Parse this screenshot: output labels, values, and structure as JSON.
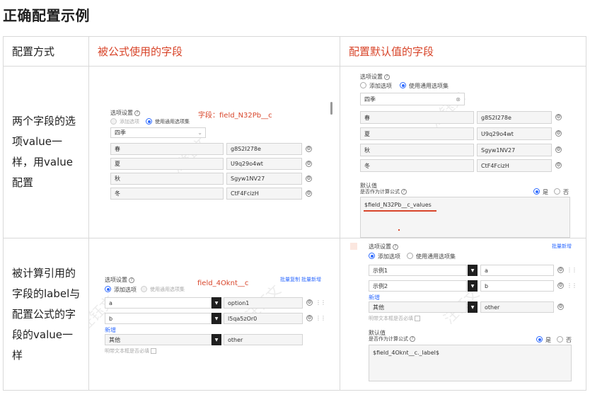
{
  "title": "正确配置示例",
  "table": {
    "headers": [
      "配置方式",
      "被公式使用的字段",
      "配置默认值的字段"
    ],
    "rows": [
      {
        "desc": "两个字段的选项value一样，用value配置"
      },
      {
        "desc": "被计算引用的字段的label与配置公式的字段的value一样"
      }
    ]
  },
  "watermark": "汪钰文",
  "shots": {
    "r1_left": {
      "section_label": "选项设置",
      "radio_add": "添加选项",
      "radio_common": "使用通用选项集",
      "annotation": "字段：field_N32Pb__c",
      "select_value": "四季",
      "options": [
        {
          "label": "春",
          "value": "g8S2I278e"
        },
        {
          "label": "夏",
          "value": "U9q29o4wt"
        },
        {
          "label": "秋",
          "value": "Sgyw1NV27"
        },
        {
          "label": "冬",
          "value": "CtF4FcizH"
        }
      ]
    },
    "r1_right": {
      "section_label": "选项设置",
      "radio_add": "添加选项",
      "radio_common": "使用通用选项集",
      "select_value": "四季",
      "options": [
        {
          "label": "春",
          "value": "g8S2I278e"
        },
        {
          "label": "夏",
          "value": "U9q29o4wt"
        },
        {
          "label": "秋",
          "value": "Sgyw1NV27"
        },
        {
          "label": "冬",
          "value": "CtF4FcizH"
        }
      ],
      "default_label": "默认值",
      "formula_label": "是否作为计算公式",
      "yes": "是",
      "no": "否",
      "formula": "$field_N32Pb__c_values"
    },
    "r2_left": {
      "section_label": "选项设置",
      "radio_add": "添加选项",
      "radio_common": "使用通用选项集",
      "link_batch_copy": "批量复制",
      "link_batch_new": "批量新增",
      "annotation": "field_4Oknt__c",
      "options": [
        {
          "label": "a",
          "value": "option1"
        },
        {
          "label": "b",
          "value": "l5qa5zOr0"
        }
      ],
      "add_link": "新增",
      "other_label": "其他",
      "other_value": "other",
      "other_required": "明带文本框是否必填"
    },
    "r2_right": {
      "section_label": "选项设置",
      "link_batch_new": "批量新增",
      "radio_add": "添加选项",
      "radio_common": "使用通用选项集",
      "options": [
        {
          "label": "示例1",
          "value": "a"
        },
        {
          "label": "示例2",
          "value": "b"
        }
      ],
      "add_link": "新增",
      "other_label": "其他",
      "other_value": "other",
      "other_required": "明带文本框是否必填",
      "default_label": "默认值",
      "formula_label": "是否作为计算公式",
      "yes": "是",
      "no": "否",
      "formula": "$field_4Oknt__c._label$"
    }
  }
}
